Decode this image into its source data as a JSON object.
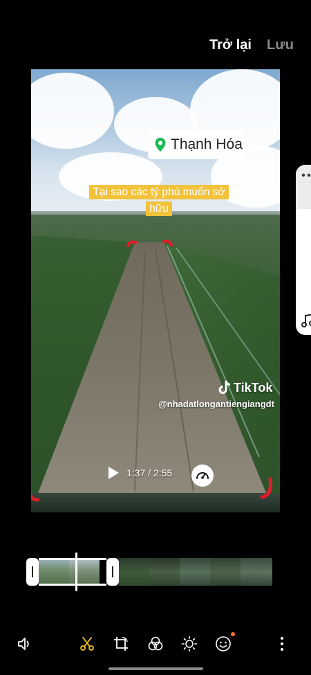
{
  "header": {
    "back_label": "Trở lại",
    "save_label": "Lưu"
  },
  "preview": {
    "location": "Thạnh Hóa",
    "caption": "Tại sao các tỷ phú muốn sở hữu",
    "watermark": {
      "brand": "TikTok",
      "handle": "@nhadatlongantiengiangdt"
    },
    "time": "1:37 / 2:55"
  },
  "toolbar": {
    "icons": [
      "volume-icon",
      "scissors-icon",
      "crop-rotate-icon",
      "filters-icon",
      "brightness-icon",
      "sticker-icon",
      "more-icon"
    ],
    "active": "scissors-icon",
    "accent": "#f5c518"
  },
  "colors": {
    "caption_bg": "#f2c23b",
    "notification_dot": "#ff6b2e",
    "crop_marks": "#e11d2a"
  }
}
